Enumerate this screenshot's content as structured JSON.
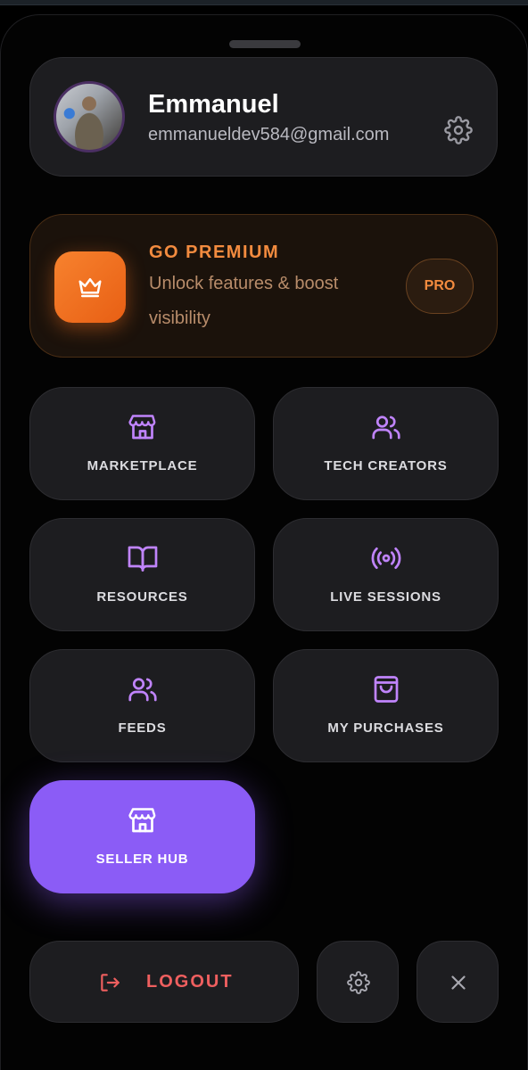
{
  "profile": {
    "name": "Emmanuel",
    "email": "emmanueldev584@gmail.com"
  },
  "premium": {
    "title": "GO PREMIUM",
    "description": "Unlock features & boost visibility",
    "badge": "PRO"
  },
  "menu": [
    {
      "label": "MARKETPLACE",
      "icon": "store-icon"
    },
    {
      "label": "TECH CREATORS",
      "icon": "users-icon"
    },
    {
      "label": "RESOURCES",
      "icon": "book-icon"
    },
    {
      "label": "LIVE SESSIONS",
      "icon": "broadcast-icon"
    },
    {
      "label": "FEEDS",
      "icon": "users-icon"
    },
    {
      "label": "MY PURCHASES",
      "icon": "shopping-bag-icon"
    },
    {
      "label": "SELLER HUB",
      "icon": "store-icon",
      "active": true
    }
  ],
  "footer": {
    "logout_label": "LOGOUT"
  },
  "colors": {
    "accent": "#8b5cf6",
    "icon_purple": "#c084fc",
    "premium_orange": "#f38b3f",
    "logout_red": "#ef5f5f",
    "card_bg": "#1d1d20"
  }
}
